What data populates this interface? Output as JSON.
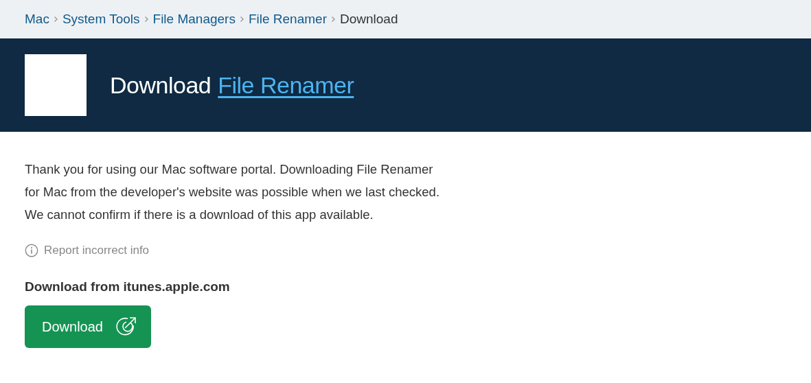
{
  "breadcrumb": [
    {
      "label": "Mac",
      "kind": "link"
    },
    {
      "label": "System Tools",
      "kind": "link"
    },
    {
      "label": "File Managers",
      "kind": "link"
    },
    {
      "label": "File Renamer",
      "kind": "link"
    },
    {
      "label": "Download",
      "kind": "current"
    }
  ],
  "header": {
    "prefix": "Download",
    "app_link": "File Renamer"
  },
  "intro": "Thank you for using our Mac software portal. Downloading File Renamer for Mac from the developer's website was possible when we last checked. We cannot confirm if there is a download of this app available.",
  "report_link": "Report incorrect info",
  "source_heading": "Download from itunes.apple.com",
  "download_button": "Download"
}
